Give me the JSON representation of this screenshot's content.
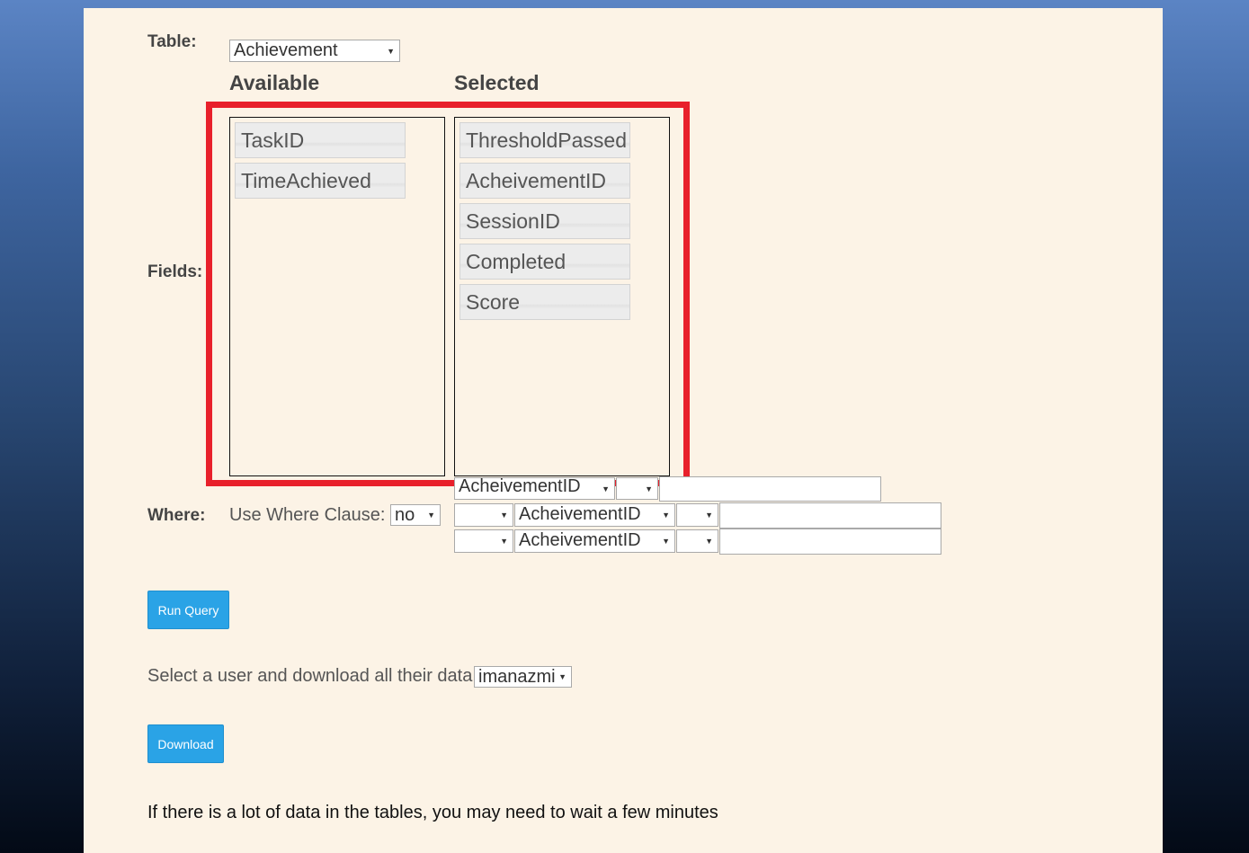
{
  "form": {
    "table_label": "Table:",
    "table_value": "Achievement",
    "available_heading": "Available",
    "selected_heading": "Selected",
    "fields_label": "Fields:",
    "available_fields": [
      "TaskID",
      "TimeAchieved"
    ],
    "selected_fields": [
      "ThresholdPassed",
      "AcheivementID",
      "SessionID",
      "Completed",
      "Score"
    ],
    "where_label": "Where:",
    "use_where_label": "Use Where Clause:",
    "use_where_value": "no",
    "where_rows": [
      {
        "connector": "",
        "field": "AcheivementID",
        "operator": "",
        "value": ""
      },
      {
        "connector": "",
        "field": "AcheivementID",
        "operator": "",
        "value": ""
      },
      {
        "connector": "",
        "field": "AcheivementID",
        "operator": "",
        "value": ""
      }
    ],
    "run_query_label": "Run Query",
    "download_prompt": "Select a user and download all their data",
    "user_value": "imanazmi",
    "download_label": "Download",
    "wait_note": "If there is a lot of data in the tables, you may need to wait a few minutes"
  },
  "colors": {
    "panel_bg": "#fcf3e6",
    "highlight": "#e8202b",
    "button": "#2aa3e6"
  }
}
